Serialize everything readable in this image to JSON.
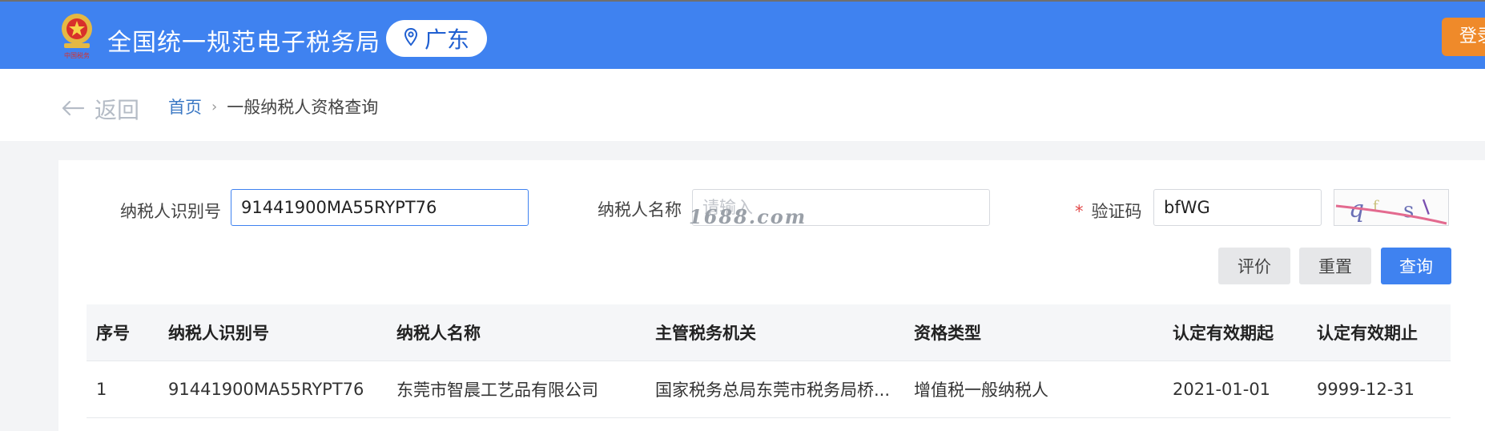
{
  "header": {
    "app_title": "全国统一规范电子税务局",
    "region": "广东",
    "login_label": "登录",
    "emblem_text": "中国税务",
    "colors": {
      "bar": "#3f82f0",
      "login": "#ef8a2a"
    }
  },
  "nav": {
    "back_label": "返回",
    "breadcrumb_home": "首页",
    "breadcrumb_sep": "›",
    "breadcrumb_current": "一般纳税人资格查询"
  },
  "form": {
    "taxpayer_id_label": "纳税人识别号",
    "taxpayer_id_value": "91441900MA55RYPT76",
    "taxpayer_name_label": "纳税人名称",
    "taxpayer_name_placeholder": "请输入",
    "captcha_label": "验证码",
    "captcha_required_mark": "*",
    "captcha_value": "bfWG",
    "captcha_image_text": "q f s l",
    "watermark": "1688.com"
  },
  "buttons": {
    "evaluate": "评价",
    "reset": "重置",
    "search": "查询"
  },
  "table": {
    "columns": [
      "序号",
      "纳税人识别号",
      "纳税人名称",
      "主管税务机关",
      "资格类型",
      "认定有效期起",
      "认定有效期止"
    ],
    "rows": [
      [
        "1",
        "91441900MA55RYPT76",
        "东莞市智晨工艺品有限公司",
        "国家税务总局东莞市税务局桥...",
        "增值税一般纳税人",
        "2021-01-01",
        "9999-12-31"
      ]
    ]
  }
}
